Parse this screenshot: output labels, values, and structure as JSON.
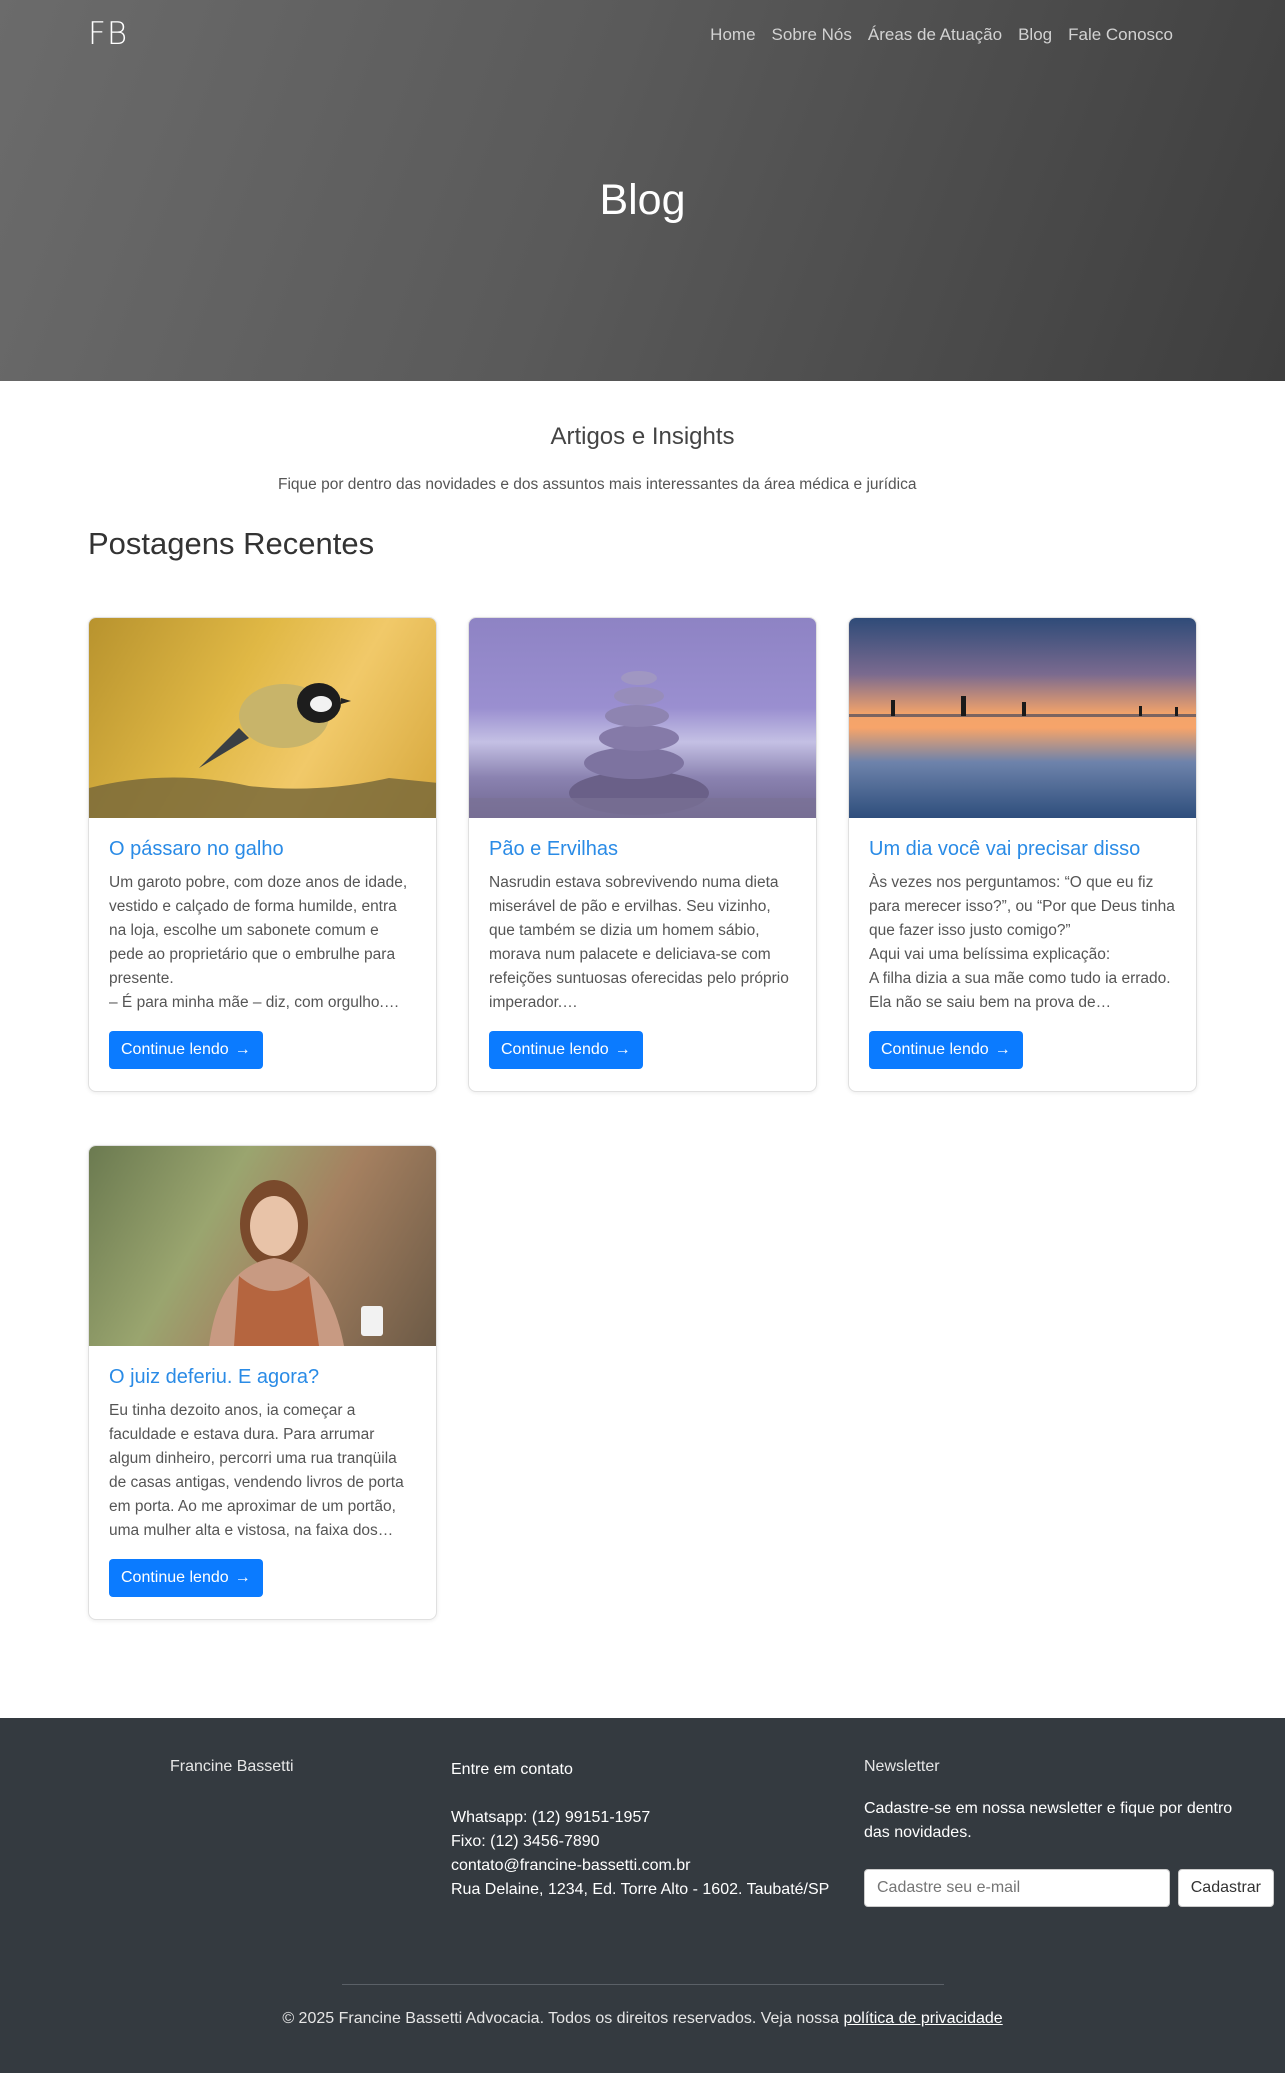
{
  "header": {
    "brand": "FB",
    "nav": [
      "Home",
      "Sobre Nós",
      "Áreas de Atuação",
      "Blog",
      "Fale Conosco"
    ],
    "hero_title": "Blog"
  },
  "intro": {
    "title": "Artigos e Insights",
    "subtitle": "Fique por dentro das novidades e dos assuntos mais interessantes da área médica e jurídica"
  },
  "recent_title": "Postagens Recentes",
  "posts": [
    {
      "image": "bird-on-branch-photo",
      "title": "O pássaro no galho",
      "excerpt": "Um garoto pobre, com doze anos de idade, vestido e calçado de forma humilde, entra na loja, escolhe um sabonete comum e pede ao proprietário que o embrulhe para presente.\n– É para minha mãe – diz, com orgulho.…",
      "button": "Continue lendo"
    },
    {
      "image": "stacked-stones-photo",
      "title": "Pão e Ervilhas",
      "excerpt": "Nasrudin estava sobrevivendo numa dieta miserável de pão e ervilhas. Seu vizinho, que também se dizia um homem sábio, morava num palacete e deliciava-se com refeições suntuosas oferecidas pelo próprio imperador.…",
      "button": "Continue lendo"
    },
    {
      "image": "beach-sunset-photo",
      "title": "Um dia você vai precisar disso",
      "excerpt": "Às vezes nos perguntamos: “O que eu fiz para merecer isso?”, ou “Por que Deus tinha que fazer isso justo comigo?”\nAqui vai uma belíssima explicação:\nA filha dizia a sua mãe como tudo ia errado. Ela não se saiu bem na prova de…",
      "button": "Continue lendo"
    },
    {
      "image": "smiling-woman-photo",
      "title": "O juiz deferiu. E agora?",
      "excerpt": "Eu tinha dezoito anos, ia começar a faculdade e estava dura. Para arrumar algum dinheiro, percorri uma rua tranqüila de casas antigas, vendendo livros de porta em porta. Ao me aproximar de um portão, uma mulher alta e vistosa, na faixa dos…",
      "button": "Continue lendo"
    }
  ],
  "footer": {
    "name": "Francine Bassetti",
    "contact_title": "Entre em contato",
    "whatsapp": "Whatsapp: (12) 99151-1957",
    "fixo": "Fixo: (12) 3456-7890",
    "email": "contato@francine-bassetti.com.br",
    "address": "Rua Delaine, 1234, Ed. Torre Alto - 1602. Taubaté/SP",
    "newsletter_title": "Newsletter",
    "newsletter_text": "Cadastre-se em nossa newsletter e fique por dentro das novidades.",
    "newsletter_placeholder": "Cadastre seu e-mail",
    "newsletter_button": "Cadastrar",
    "copyright": "© 2025 Francine Bassetti Advocacia. Todos os direitos reservados. Veja nossa",
    "privacy_link": "política de privacidade"
  }
}
